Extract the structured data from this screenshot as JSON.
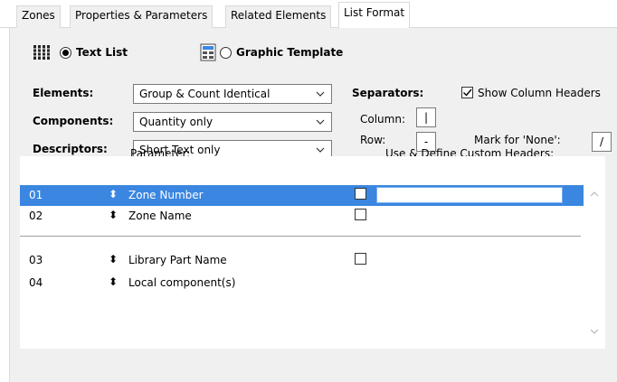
{
  "tabs": [
    {
      "label": "Zones"
    },
    {
      "label": "Properties & Parameters"
    },
    {
      "label": "Related Elements"
    },
    {
      "label": "List Format"
    }
  ],
  "format": {
    "text_list_label": "Text List",
    "graphic_template_label": "Graphic Template",
    "selected": "text_list"
  },
  "elements": {
    "label": "Elements:",
    "value": "Group & Count Identical"
  },
  "components": {
    "label": "Components:",
    "value": "Quantity only"
  },
  "descriptors": {
    "label": "Descriptors:",
    "value": "Short Text only"
  },
  "separators": {
    "label": "Separators:",
    "show_headers_label": "Show Column Headers",
    "show_headers_checked": true,
    "column_label": "Column:",
    "column_value": "|",
    "row_label": "Row:",
    "row_value": "-",
    "mark_none_label": "Mark for 'None':",
    "mark_none_value": "/"
  },
  "list": {
    "parameter_header": "Parameter:",
    "custom_header": "Use & Define Custom Headers:",
    "rows": [
      {
        "num": "01",
        "name": "Zone Number",
        "selected": true,
        "has_checkbox": true
      },
      {
        "num": "02",
        "name": "Zone Name",
        "selected": false,
        "has_checkbox": true
      },
      {
        "num": "03",
        "name": "Library Part Name",
        "selected": false,
        "has_checkbox": true
      },
      {
        "num": "04",
        "name": "Local component(s)",
        "selected": false,
        "has_checkbox": false
      }
    ]
  },
  "colors": {
    "selection": "#3a86e0",
    "panel": "#f0f0f0"
  }
}
